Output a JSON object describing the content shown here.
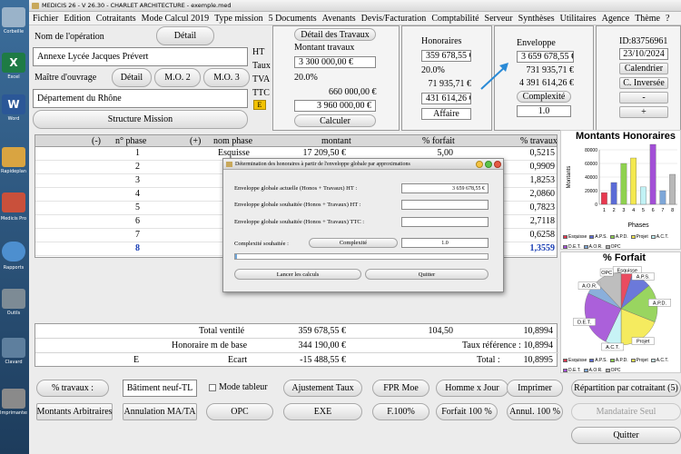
{
  "window": {
    "title": "MEDICIS 26  - V 26.30 - CHARLET ARCHITECTURE - exemple.med"
  },
  "desktop": [
    {
      "label": "Corbeille",
      "color": "#9ab3c9"
    },
    {
      "label": "Excel",
      "color": "#1e7b45"
    },
    {
      "label": "Word",
      "color": "#2b5797"
    },
    {
      "label": "Rapideplan",
      "color": "#d9a441"
    },
    {
      "label": "Medicis Pro",
      "color": "#c9503b"
    },
    {
      "label": "Rapports",
      "color": "#4d8fcf"
    },
    {
      "label": "Outils",
      "color": "#7d8b95"
    },
    {
      "label": "Clavard",
      "color": "#5e7f9e"
    },
    {
      "label": "Imprimantes",
      "color": "#8a8a8a"
    }
  ],
  "menu": [
    "Fichier",
    "Edition",
    "Cotraitants",
    "Mode Calcul 2019",
    "Type mission",
    "5 Documents",
    "Avenants",
    "Devis/Facturation",
    "Comptabilité",
    "Serveur",
    "Synthèses",
    "Utilitaires",
    "Agence",
    "Thème",
    "?"
  ],
  "operation": {
    "label_nom": "Nom de l'opération",
    "detail_label": "Détail",
    "nom_value": "Annexe Lycée Jacques Prévert",
    "label_maitre": "Maître d'ouvrage",
    "detail2_label": "Détail",
    "mo2_label": "M.O. 2",
    "mo3_label": "M.O. 3",
    "maitre_value": "Département du Rhône",
    "structure_label": "Structure Mission"
  },
  "tax_labels": {
    "ht": "HT",
    "taux": "Taux",
    "tva": "TVA",
    "ttc": "TTC",
    "e_badge": "E"
  },
  "travaux": {
    "detail_label": "Détail des Travaux",
    "montant_label": "Montant travaux",
    "montant_value": "3 300 000,00 €",
    "tva_rate": "20.0%",
    "tva_value": "660 000,00 €",
    "ttc_value": "3 960 000,00 €",
    "calculer_label": "Calculer"
  },
  "honoraires": {
    "title": "Honoraires",
    "ht_value": "359 678,55 €",
    "tva_rate": "20.0%",
    "tva_value": "71 935,71 €",
    "ttc_value": "431 614,26 €",
    "affaire_label": "Affaire"
  },
  "enveloppe": {
    "title": "Enveloppe",
    "ht_value": "3 659 678,55 €",
    "tva_value": "731 935,71 €",
    "ttc_value": "4 391 614,26 €",
    "complexite_label": "Complexité",
    "complexite_value": "1.0"
  },
  "idbox": {
    "id_text": "ID:83756961",
    "date_value": "23/10/2024",
    "calendrier_label": "Calendrier",
    "inverse_label": "C. Inversée",
    "minus_label": "-",
    "plus_label": "+"
  },
  "grid": {
    "headers": [
      "(-)",
      "n° phase",
      "(+)",
      "nom phase",
      "montant",
      "% forfait",
      "% travaux"
    ],
    "rows": [
      {
        "n": "1",
        "nom": "Esquisse",
        "montant": "17 209,50 €",
        "forfait": "5,00",
        "travaux": "0,5215"
      },
      {
        "n": "2",
        "nom": "",
        "montant": "",
        "forfait": "",
        "travaux": "0,9909"
      },
      {
        "n": "3",
        "nom": "A",
        "montant": "",
        "forfait": "",
        "travaux": "1,8253"
      },
      {
        "n": "4",
        "nom": "",
        "montant": "",
        "forfait": "",
        "travaux": "2,0860"
      },
      {
        "n": "5",
        "nom": "A",
        "montant": "",
        "forfait": "",
        "travaux": "0,7823"
      },
      {
        "n": "6",
        "nom": "D",
        "montant": "",
        "forfait": "",
        "travaux": "2,7118"
      },
      {
        "n": "7",
        "nom": "A",
        "montant": "",
        "forfait": "",
        "travaux": "0,6258"
      },
      {
        "n": "8",
        "nom": "",
        "montant": "",
        "forfait": "",
        "travaux": "1,3559"
      }
    ]
  },
  "totals": {
    "total_ventile_label": "Total ventilé",
    "total_ventile_value": "359 678,55 €",
    "total_ventile_forfait": "104,50",
    "total_ventile_travaux": "10,8994",
    "honoraire_base_label": "Honoraire m de base",
    "honoraire_base_value": "344 190,00 €",
    "taux_ref_label": "Taux référence :",
    "taux_ref_value": "10,8994",
    "ecart_prefix": "E",
    "ecart_label": "Ecart",
    "ecart_value": "-15 488,55 €",
    "total_label": "Total :",
    "total_value": "10,8995"
  },
  "bottom": {
    "travaux_label": "% travaux :",
    "batiment_value": "Bâtiment neuf-TL",
    "mode_tableur_label": "Mode tableur",
    "ajustement_label": "Ajustement Taux",
    "fpr_label": "FPR Moe",
    "homme_label": "Homme x Jour",
    "imprimer_label": "Imprimer",
    "repartition_label": "Répartition par cotraitant (5)",
    "arbitraires_label": "Montants Arbitraires",
    "annulation_label": "Annulation MA/TA",
    "opc_label": "OPC",
    "exe_label": "EXE",
    "f100_label": "F.100%",
    "forfait_label": "Forfait 100 %",
    "annul_label": "Annul. 100 %",
    "mandataire_label": "Mandataire Seul",
    "quitter_label": "Quitter"
  },
  "dialog": {
    "title": "Détermination des honoraires à partir de l'enveloppe globale par approximations",
    "actuelle_label": "Enveloppe globale actuelle (Honos + Travaux) HT :",
    "actuelle_value": "3 659 678,55 €",
    "souhaitee_ht_label": "Enveloppe globale souhaitée (Honos + Travaux) HT :",
    "souhaitee_ttc_label": "Enveloppe globale souhaitée (Honos + Travaux) TTC :",
    "complexite_label": "Complexité souhaitée :",
    "complexite_button": "Complexité",
    "complexite_value": "1.0",
    "lancer_label": "Lancer les calculs",
    "quitter_label": "Quitter"
  },
  "legend": [
    "Esquisse",
    "A.P.S.",
    "A.P.D.",
    "Projet",
    "A.C.T.",
    "D.E.T.",
    "A.O.R.",
    "OPC"
  ],
  "colors": {
    "esquisse": "#e8384f",
    "aps": "#5b6bd6",
    "apd": "#8fd14f",
    "projet": "#f4e94e",
    "act": "#c1f2f5",
    "det": "#a24fd6",
    "aor": "#7ea7d8",
    "opc": "#b8b8b8",
    "accent_arrow": "#2a8ad6",
    "e_badge": "#f2c200"
  },
  "chart_data": [
    {
      "type": "bar",
      "title": "Montants Honoraires",
      "xlabel": "Phases",
      "ylabel": "Montants",
      "categories": [
        "1",
        "2",
        "3",
        "4",
        "5",
        "6",
        "7",
        "8"
      ],
      "values": [
        17209,
        32000,
        60000,
        68000,
        25500,
        88000,
        20000,
        44000
      ],
      "ylim": [
        0,
        80000
      ],
      "yticks": [
        "0",
        "20000",
        "40000",
        "60000",
        "80000"
      ]
    },
    {
      "type": "pie",
      "title": "% Forfait",
      "labels": [
        "Esquisse",
        "A.P.S.",
        "A.P.D.",
        "Projet",
        "A.C.T.",
        "D.E.T.",
        "A.O.R.",
        "OPC"
      ],
      "values": [
        5,
        9,
        17,
        19,
        7,
        25,
        6,
        12
      ]
    }
  ]
}
